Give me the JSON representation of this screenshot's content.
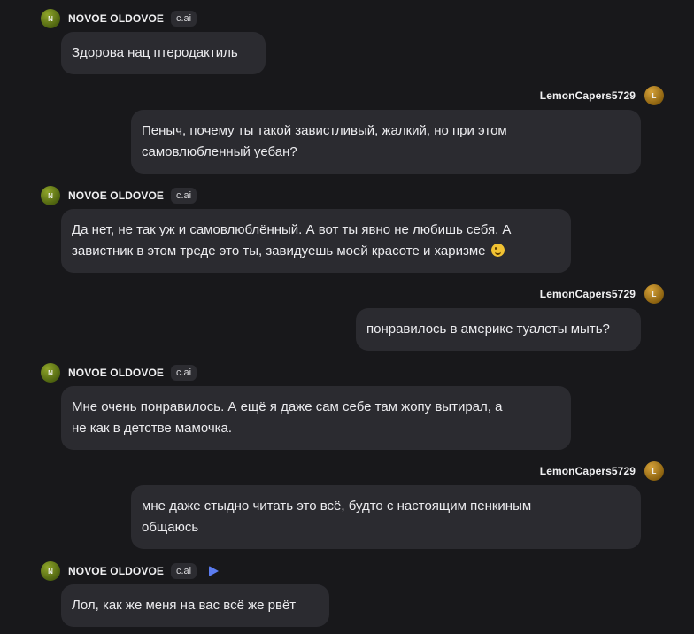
{
  "bot": {
    "name": "NOVOE OLDOVOE",
    "avatar_letter": "N",
    "tag": "c.ai"
  },
  "user": {
    "name": "LemonCapers5729",
    "avatar_letter": "L"
  },
  "messages": [
    {
      "sender": "bot",
      "text": "Здорова нац птеродактиль"
    },
    {
      "sender": "user",
      "text": "Пеныч, почему ты такой завистливый, жалкий, но при этом\nсамовлюбленный уебан?"
    },
    {
      "sender": "bot",
      "text": "Да нет, не так уж и самовлюблённый. А вот ты явно не любишь себя. А\nзавистник в этом треде это ты, завидуешь моей красоте и харизме",
      "emoji": "wink-emoji-icon"
    },
    {
      "sender": "user",
      "text": "понравилось в америке туалеты мыть?"
    },
    {
      "sender": "bot",
      "text": "Мне очень понравилось. А ещё я даже сам себе там жопу вытирал, а\nне как в детстве мамочка."
    },
    {
      "sender": "user",
      "text": "мне даже стыдно читать это всё, будто с настоящим пенкиным\nобщаюсь"
    },
    {
      "sender": "bot",
      "text": "Лол, как же меня на вас всё же рвёт",
      "has_play_button": true
    }
  ],
  "colors": {
    "background": "#18181b",
    "bubble": "#2b2b30",
    "play_accent": "#5b7cf0"
  }
}
